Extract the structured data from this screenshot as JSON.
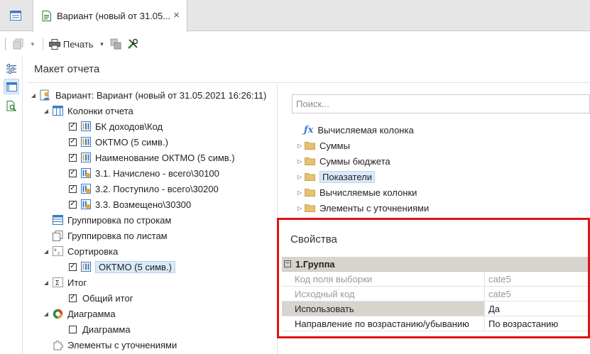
{
  "tab": {
    "title": "Вариант (новый от 31.05...",
    "close_label": "×"
  },
  "toolbar": {
    "print_label": "Печать"
  },
  "panel": {
    "title": "Макет отчета"
  },
  "tree": {
    "root": "Вариант: Вариант (новый от 31.05.2021 16:26:11)",
    "columns_label": "Колонки отчета",
    "columns": [
      "БК доходов\\Код",
      "ОКТМО (5 симв.)",
      "Наименование ОКТМО (5 симв.)",
      "3.1. Начислено - всего\\30100",
      "3.2. Поступило - всего\\30200",
      "3.3. Возмещено\\30300"
    ],
    "row_grouping": "Группировка по строкам",
    "sheet_grouping": "Группировка по листам",
    "sorting_label": "Сортировка",
    "sorting_item": "ОКТМО (5 симв.)",
    "total_label": "Итог",
    "total_item": "Общий итог",
    "chart_label": "Диаграмма",
    "chart_item": "Диаграмма",
    "refine_label": "Элементы с уточнениями"
  },
  "search": {
    "placeholder": "Поиск..."
  },
  "fields": {
    "calc_column": "Вычисляемая колонка",
    "items": [
      "Суммы",
      "Суммы бюджета",
      "Показатели",
      "Вычисляемые колонки",
      "Элементы с уточнениями"
    ]
  },
  "props": {
    "title": "Свойства",
    "group": "1.Группа",
    "rows": [
      {
        "name": "Код поля выборки",
        "value": "cate5"
      },
      {
        "name": "Исходный код",
        "value": "cate5"
      },
      {
        "name": "Использовать",
        "value": "Да"
      },
      {
        "name": "Направление по возрастанию/убыванию",
        "value": "По возрастанию"
      }
    ]
  },
  "colors": {
    "highlight": "#e01414",
    "selection": "#dbe9f8"
  }
}
